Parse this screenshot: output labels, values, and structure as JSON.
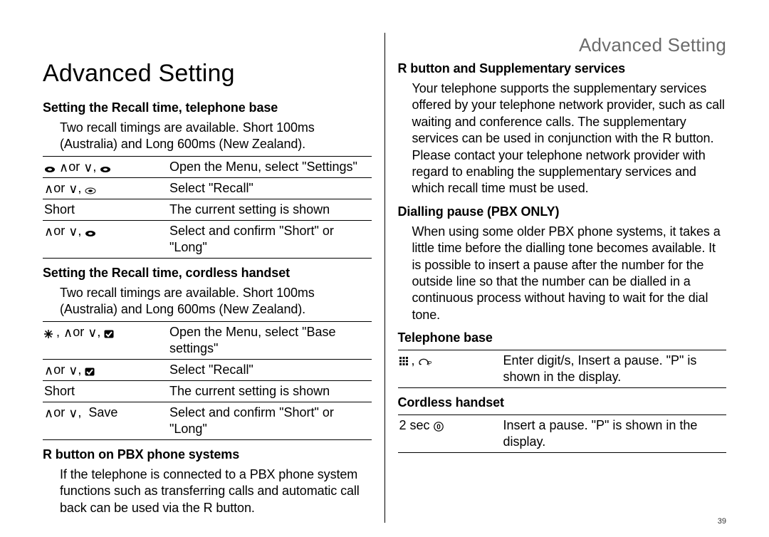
{
  "pageNumber": "39",
  "runningHeader": "Advanced Setting",
  "left": {
    "title": "Advanced Setting",
    "section1": {
      "heading": "Setting the Recall time, telephone base",
      "intro": "Two recall timings are available. Short 100ms (Australia) and Long 600ms (New Zealand).",
      "rows": [
        {
          "key": "⦿ ∧ or ∨ , ⦿",
          "desc": "Open the Menu, select \"Settings\""
        },
        {
          "key": "∧ or ∨ , ⦿",
          "desc": "Select \"Recall\""
        },
        {
          "key": "Short",
          "desc": "The current setting is shown"
        },
        {
          "key": "∧ or ∨ , ⦿",
          "desc": "Select and confirm \"Short\" or \"Long\""
        }
      ]
    },
    "section2": {
      "heading": "Setting the Recall time, cordless handset",
      "intro": "Two recall timings are available. Short 100ms (Australia) and Long 600ms (New Zealand).",
      "rows": [
        {
          "key": "✦ , ∧ or ∨, ☑",
          "desc": "Open the Menu, select \"Base settings\""
        },
        {
          "key": "∧ or ∨, ☑",
          "desc": "Select \"Recall\""
        },
        {
          "key": "Short",
          "desc": "The current setting is shown"
        },
        {
          "key": "∧ or ∨,  Save",
          "desc": "Select and confirm \"Short\" or \"Long\""
        }
      ]
    },
    "section3": {
      "heading": "R button on PBX phone systems",
      "intro": "If the telephone is connected to a PBX phone system functions such as transferring calls and automatic call back can be used via the R button."
    }
  },
  "right": {
    "section1": {
      "heading": "R button and Supplementary services",
      "intro": "Your telephone supports the supplementary services offered by your telephone network provider, such as call waiting and conference calls. The supplementary services can be used in conjunction with the R button. Please contact your telephone network provider with regard to enabling the supplementary services and which recall time must be used."
    },
    "section2": {
      "heading": "Dialling pause (PBX ONLY)",
      "intro": "When using some older PBX phone systems, it takes a little time before the dialling tone becomes available. It is possible to insert a pause after the number for the outside line so that the number can be dialled in a continuous process without having to wait for the dial tone."
    },
    "section3": {
      "heading": "Telephone base",
      "rows": [
        {
          "key": "⌨ , ⤺ᴾ",
          "desc": "Enter digit/s, Insert a pause. \"P\" is shown in the display."
        }
      ]
    },
    "section4": {
      "heading": "Cordless handset",
      "rows": [
        {
          "key": "2 sec ⓪",
          "desc": "Insert a pause. \"P\" is shown in the display."
        }
      ]
    }
  },
  "icons": {
    "oval": "oval-button-icon",
    "up": "up-arrow-icon",
    "down": "down-arrow-icon",
    "check": "checkmark-box-icon",
    "star": "star-nav-icon",
    "keypad": "keypad-icon",
    "redial": "redial-p-icon",
    "zero": "zero-key-icon"
  }
}
